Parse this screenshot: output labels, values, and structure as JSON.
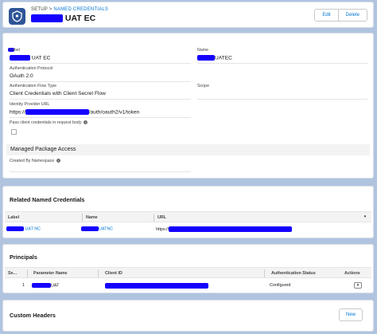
{
  "header": {
    "breadcrumb_prefix": "SETUP",
    "breadcrumb_sep": ">",
    "breadcrumb_link": "NAMED CREDENTIALS",
    "title_suffix": "UAT EC",
    "edit_label": "Edit",
    "delete_label": "Delete"
  },
  "detail": {
    "label_label": "Label",
    "label_value_suffix": "UAT EC",
    "name_label": "Name",
    "name_value_suffix": "UATEC",
    "auth_protocol_label": "Authentication Protocol",
    "auth_protocol_value": "OAuth 2.0",
    "auth_flow_label": "Authentication Flow Type",
    "auth_flow_value": "Client Credentials with Client Secret Flow",
    "scope_label": "Scope",
    "idp_url_label": "Identity Provider URL",
    "idp_url_prefix": "https://",
    "idp_url_suffix": "/auth/oauth2/v1/token",
    "pass_creds_label": "Pass client credentials in request body",
    "managed_package_title": "Managed Package Access",
    "created_by_ns_label": "Created By Namespace"
  },
  "related": {
    "title": "Related Named Credentials",
    "columns": [
      "Label",
      "Name",
      "URL"
    ],
    "rows": [
      {
        "label_suffix": "UAT NC",
        "name_suffix": "UATNC",
        "url_prefix": "https://"
      }
    ]
  },
  "principals": {
    "title": "Principals",
    "columns": [
      "Se...",
      "Parameter Name",
      "Client ID",
      "Authentication Status",
      "Actions"
    ],
    "rows": [
      {
        "seq": "1",
        "param_suffix": "UAT",
        "status": "Configured"
      }
    ]
  },
  "custom_headers": {
    "title": "Custom Headers",
    "new_label": "New"
  },
  "colors": {
    "brand": "#0176d3",
    "redaction": "#1500ff",
    "background": "#b0c4df"
  },
  "icons": [
    "named-credential-icon",
    "info-icon",
    "chevron-down-icon"
  ]
}
